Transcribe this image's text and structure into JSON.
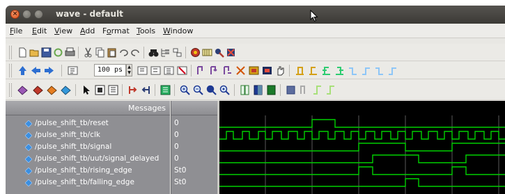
{
  "window": {
    "title": "wave - default"
  },
  "menu": [
    {
      "label": "File",
      "u": "F"
    },
    {
      "label": "Edit",
      "u": "E"
    },
    {
      "label": "View",
      "u": "V"
    },
    {
      "label": "Add",
      "u": "A"
    },
    {
      "label": "Format",
      "u": "o"
    },
    {
      "label": "Tools",
      "u": "T"
    },
    {
      "label": "Window",
      "u": "W"
    }
  ],
  "toolbar": {
    "zoom_value": "100 ps"
  },
  "messages_header": "Messages",
  "signals": [
    {
      "name": "/pulse_shift_tb/reset",
      "value": "0"
    },
    {
      "name": "/pulse_shift_tb/clk",
      "value": "0"
    },
    {
      "name": "/pulse_shift_tb/signal",
      "value": "0"
    },
    {
      "name": "/pulse_shift_tb/uut/signal_delayed",
      "value": "0"
    },
    {
      "name": "/pulse_shift_tb/rising_edge",
      "value": "St0"
    },
    {
      "name": "/pulse_shift_tb/falling_edge",
      "value": "St0"
    }
  ],
  "colors": {
    "wave": "#00d000",
    "cursor_line": "#5a5a5a",
    "signal_icon": "#3b8fe0"
  }
}
